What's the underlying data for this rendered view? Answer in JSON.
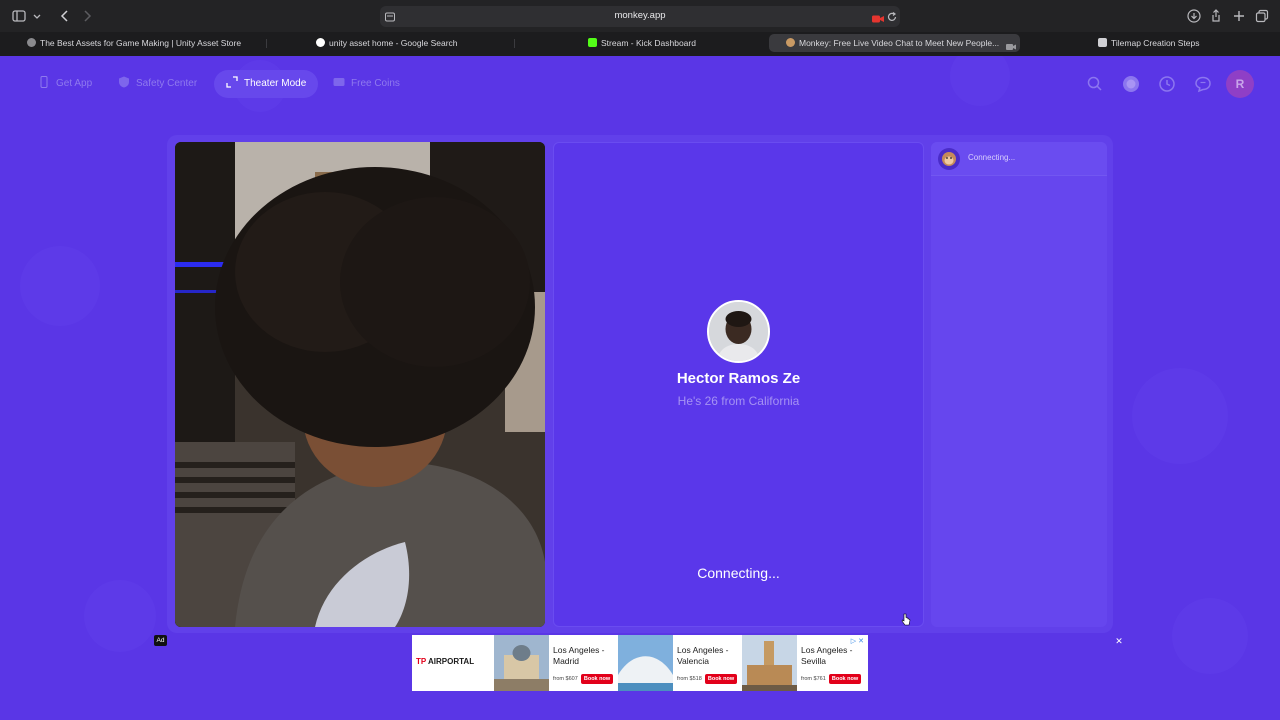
{
  "browser": {
    "url": "monkey.app",
    "tabs": [
      {
        "title": "The Best Assets for Game Making | Unity Asset Store",
        "active": false
      },
      {
        "title": "unity asset home - Google Search",
        "active": false
      },
      {
        "title": "Stream - Kick Dashboard",
        "active": false
      },
      {
        "title": "Monkey: Free Live Video Chat to Meet New People...",
        "active": true
      },
      {
        "title": "Tilemap Creation Steps",
        "active": false
      }
    ]
  },
  "nav": {
    "get_app": "Get App",
    "safety_center": "Safety Center",
    "theater_mode": "Theater Mode",
    "free_coins": "Free Coins",
    "avatar_initial": "R"
  },
  "peer": {
    "name": "Hector Ramos Ze",
    "subtitle": "He's 26 from California",
    "status": "Connecting..."
  },
  "chat": {
    "status": "Connecting..."
  },
  "ad": {
    "label": "Ad",
    "close": "✕",
    "brand": "AIRPORTAL",
    "brand_prefix": "TP",
    "book_label": "Book now",
    "offers": [
      {
        "title": "Los Angeles - Madrid",
        "price": "from $607"
      },
      {
        "title": "Los Angeles - Valencia",
        "price": "from $518"
      },
      {
        "title": "Los Angeles - Sevilla",
        "price": "from $761"
      }
    ]
  },
  "colors": {
    "page_bg": "#5a36e6",
    "panel_bg": "#6140ea",
    "accent_red": "#e2001a"
  }
}
